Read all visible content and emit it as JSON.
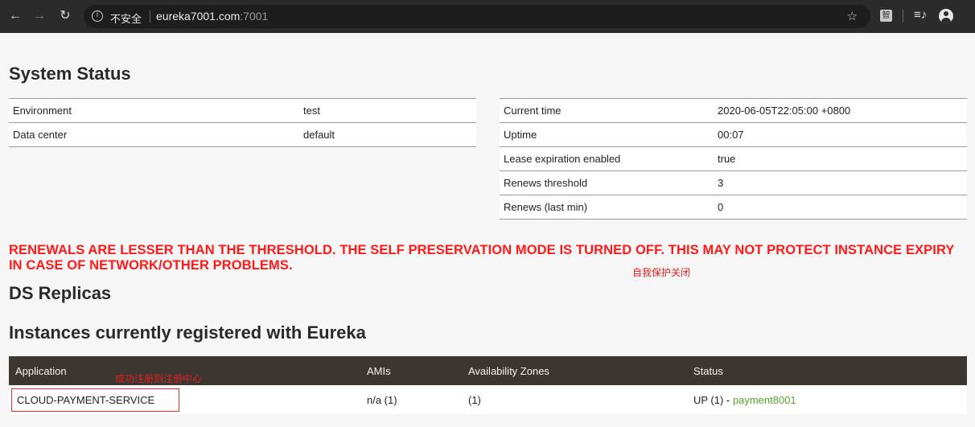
{
  "browser": {
    "insecure_label": "不安全",
    "url_host": "eureka7001.com",
    "url_port": ":7001",
    "ext_label": "智"
  },
  "system_status": {
    "title": "System Status",
    "left": [
      {
        "key": "Environment",
        "value": "test"
      },
      {
        "key": "Data center",
        "value": "default"
      }
    ],
    "right": [
      {
        "key": "Current time",
        "value": "2020-06-05T22:05:00 +0800"
      },
      {
        "key": "Uptime",
        "value": "00:07"
      },
      {
        "key": "Lease expiration enabled",
        "value": "true"
      },
      {
        "key": "Renews threshold",
        "value": "3"
      },
      {
        "key": "Renews (last min)",
        "value": "0"
      }
    ]
  },
  "warning": "RENEWALS ARE LESSER THAN THE THRESHOLD. THE SELF PRESERVATION MODE IS TURNED OFF. THIS MAY NOT PROTECT INSTANCE EXPIRY IN CASE OF NETWORK/OTHER PROBLEMS.",
  "annotations": {
    "self_protect_off": "自我保护关闭",
    "registered": "成功注册到注册中心"
  },
  "ds_replicas": {
    "title": "DS Replicas"
  },
  "instances": {
    "title": "Instances currently registered with Eureka",
    "headers": [
      "Application",
      "AMIs",
      "Availability Zones",
      "Status"
    ],
    "rows": [
      {
        "application": "CLOUD-PAYMENT-SERVICE",
        "amis": "n/a (1)",
        "zones": "(1)",
        "status_prefix": "UP (1) - ",
        "instance_link": "payment8001"
      }
    ]
  },
  "colors": {
    "warning": "#ff1a1a",
    "header_bg": "#3b3630",
    "link": "#5aa02c"
  }
}
